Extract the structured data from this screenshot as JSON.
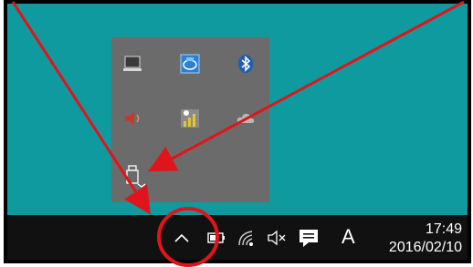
{
  "screen": {
    "desktop_color": "#0f9a9f",
    "taskbar_color": "#111112",
    "popup_color": "#6b6b6b",
    "annotation_color": "#e0151b"
  },
  "tray_popup": {
    "icons": [
      "laptop-icon",
      "intel-graphics-icon",
      "bluetooth-icon",
      "speaker-icon",
      "network-signal-icon",
      "cloud-icon",
      "usb-device-icon"
    ]
  },
  "taskbar": {
    "icons": [
      "chevron-up-icon",
      "battery-icon",
      "wifi-icon",
      "volume-muted-icon",
      "action-center-icon"
    ],
    "ime_label": "A",
    "clock": {
      "time": "17:49",
      "date": "2016/02/10"
    }
  }
}
